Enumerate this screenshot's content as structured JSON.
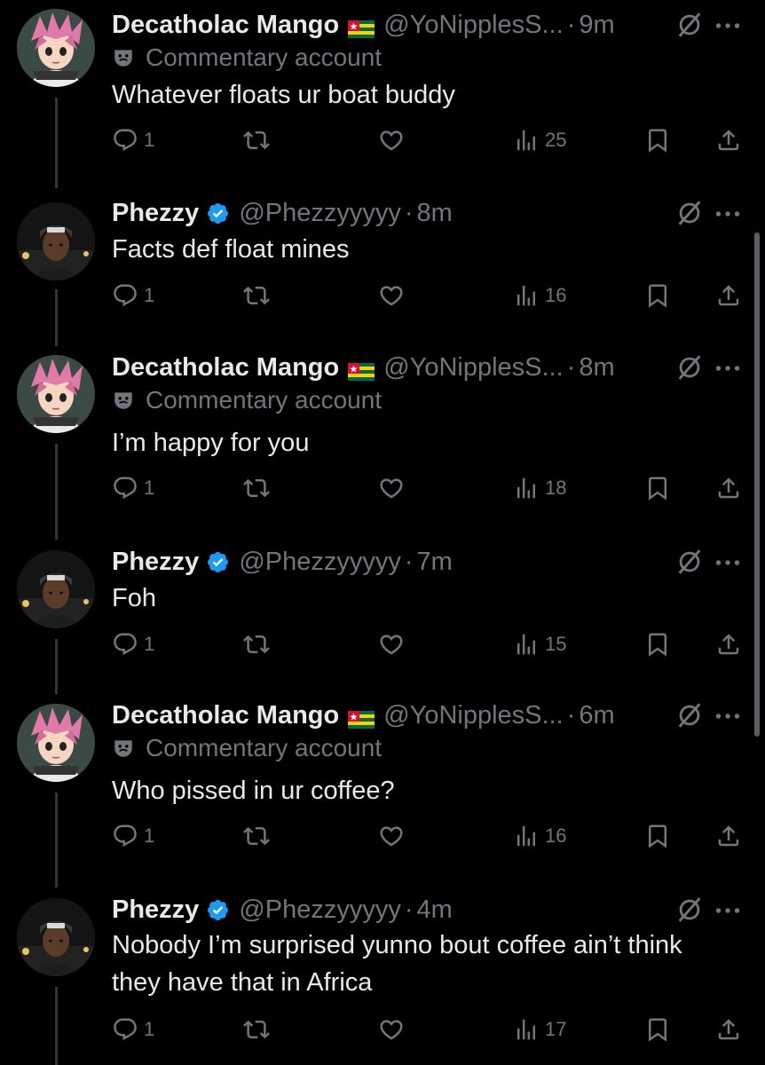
{
  "colors": {
    "background": "#000000",
    "text_primary": "#e7e9ea",
    "text_secondary": "#71767b",
    "verified": "#1d9bf0",
    "thread_line": "#333639"
  },
  "tweets": [
    {
      "name": "Decatholac Mango",
      "flag": "togo-flag",
      "verified": false,
      "handle": "@YoNipplesS...",
      "dot": "·",
      "time": "9m",
      "subline": "Commentary account",
      "text": "Whatever floats ur boat buddy",
      "replies": "1",
      "retweets": "",
      "likes": "",
      "views": "25"
    },
    {
      "name": "Phezzy",
      "verified": true,
      "handle": "@Phezzyyyyy",
      "dot": "·",
      "time": "8m",
      "text": "Facts def float mines",
      "replies": "1",
      "retweets": "",
      "likes": "",
      "views": "16"
    },
    {
      "name": "Decatholac Mango",
      "flag": "togo-flag",
      "verified": false,
      "handle": "@YoNipplesS...",
      "dot": "·",
      "time": "8m",
      "subline": "Commentary account",
      "text": "I’m happy for you",
      "replies": "1",
      "retweets": "",
      "likes": "",
      "views": "18"
    },
    {
      "name": "Phezzy",
      "verified": true,
      "handle": "@Phezzyyyyy",
      "dot": "·",
      "time": "7m",
      "text": "Foh",
      "replies": "1",
      "retweets": "",
      "likes": "",
      "views": "15"
    },
    {
      "name": "Decatholac Mango",
      "flag": "togo-flag",
      "verified": false,
      "handle": "@YoNipplesS...",
      "dot": "·",
      "time": "6m",
      "subline": "Commentary account",
      "text": "Who pissed in ur coffee?",
      "replies": "1",
      "retweets": "",
      "likes": "",
      "views": "16"
    },
    {
      "name": "Phezzy",
      "verified": true,
      "handle": "@Phezzyyyyy",
      "dot": "·",
      "time": "4m",
      "text": "Nobody I’m surprised yunno bout coffee ain’t think they have that in Africa",
      "replies": "1",
      "retweets": "",
      "likes": "",
      "views": "17"
    }
  ],
  "icons": {
    "reply": "reply-icon",
    "retweet": "retweet-icon",
    "like": "heart-icon",
    "views": "views-icon",
    "bookmark": "bookmark-icon",
    "share": "share-icon",
    "grok": "grok-icon",
    "more": "more-icon",
    "commentary": "mask-icon",
    "verified": "verified-badge-icon"
  }
}
